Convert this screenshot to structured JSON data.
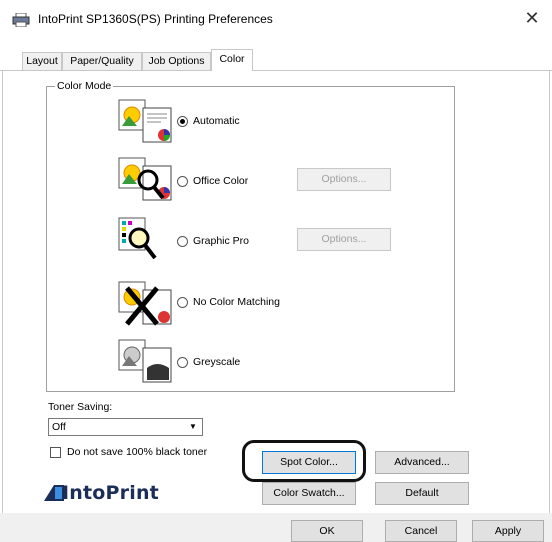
{
  "window": {
    "title": "IntoPrint SP1360S(PS) Printing Preferences",
    "close_glyph": "✕",
    "printer_icon": "printer-icon"
  },
  "tabs": [
    {
      "label": "Layout",
      "active": false
    },
    {
      "label": "Paper/Quality",
      "active": false
    },
    {
      "label": "Job Options",
      "active": false
    },
    {
      "label": "Color",
      "active": true
    }
  ],
  "color_mode": {
    "legend": "Color Mode",
    "options": [
      {
        "label": "Automatic",
        "selected": true,
        "icon": "automatic-color-icon"
      },
      {
        "label": "Office Color",
        "selected": false,
        "icon": "office-color-icon",
        "options_button": "Options..."
      },
      {
        "label": "Graphic Pro",
        "selected": false,
        "icon": "graphic-pro-icon",
        "options_button": "Options..."
      },
      {
        "label": "No Color Matching",
        "selected": false,
        "icon": "no-color-matching-icon"
      },
      {
        "label": "Greyscale",
        "selected": false,
        "icon": "greyscale-icon"
      }
    ]
  },
  "toner_saving": {
    "label": "Toner Saving:",
    "value": "Off",
    "black_toner_checkbox_label": "Do not save 100% black toner",
    "black_toner_checked": false
  },
  "buttons": {
    "spot_color": "Spot Color...",
    "advanced": "Advanced...",
    "color_swatch": "Color Swatch...",
    "default": "Default"
  },
  "logo": {
    "text": "IntoPrint"
  },
  "footer": {
    "ok": "OK",
    "cancel": "Cancel",
    "apply": "Apply"
  },
  "colors": {
    "accent": "#0078d7",
    "logo_blue": "#1d2d59",
    "highlight_ring": "#111111"
  }
}
